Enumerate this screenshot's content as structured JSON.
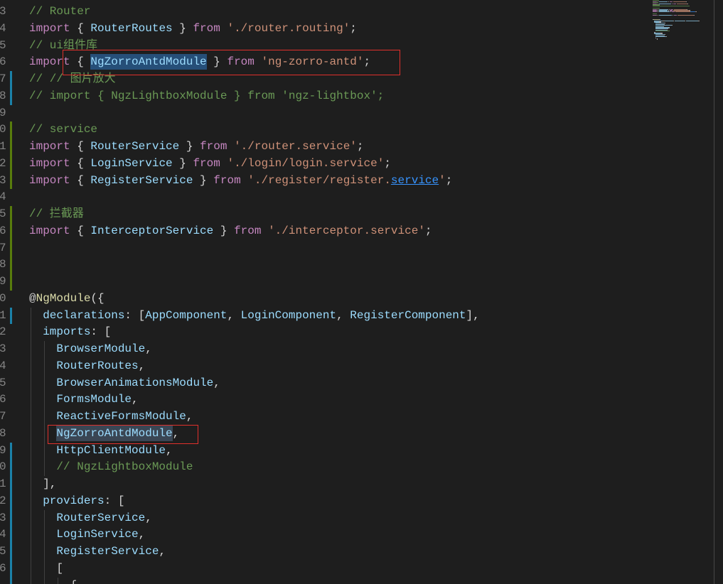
{
  "editor": {
    "lines": [
      {
        "n": "3",
        "t": [
          [
            "#6a9955",
            "// Router"
          ]
        ]
      },
      {
        "n": "4",
        "t": [
          [
            "#c586c0",
            "import"
          ],
          [
            "#d4d4d4",
            " { "
          ],
          [
            "#9cdcfe",
            "RouterRoutes"
          ],
          [
            "#d4d4d4",
            " } "
          ],
          [
            "#c586c0",
            "from"
          ],
          [
            "#d4d4d4",
            " "
          ],
          [
            "#ce9178",
            "'./router.routing'"
          ],
          [
            "#d4d4d4",
            ";"
          ]
        ]
      },
      {
        "n": "5",
        "t": [
          [
            "#6a9955",
            "// ui组件库"
          ]
        ]
      },
      {
        "n": "6",
        "t": [
          [
            "#c586c0",
            "import"
          ],
          [
            "#d4d4d4",
            " { "
          ],
          [
            "#9cdcfe",
            "NgZorroAntdModule",
            "#264f78"
          ],
          [
            "#d4d4d4",
            " } "
          ],
          [
            "#c586c0",
            "from"
          ],
          [
            "#d4d4d4",
            " "
          ],
          [
            "#ce9178",
            "'ng-zorro-antd'"
          ],
          [
            "#d4d4d4",
            ";"
          ]
        ]
      },
      {
        "n": "7",
        "g": "#1b81a8",
        "t": [
          [
            "#6a9955",
            "// // 图片放大"
          ]
        ]
      },
      {
        "n": "8",
        "g": "#1b81a8",
        "t": [
          [
            "#6a9955",
            "// import { NgzLightboxModule } from 'ngz-lightbox';"
          ]
        ]
      },
      {
        "n": "9",
        "t": []
      },
      {
        "n": "0",
        "g": "#587c0c",
        "t": [
          [
            "#6a9955",
            "// service"
          ]
        ]
      },
      {
        "n": "1",
        "g": "#587c0c",
        "t": [
          [
            "#c586c0",
            "import"
          ],
          [
            "#d4d4d4",
            " { "
          ],
          [
            "#9cdcfe",
            "RouterService"
          ],
          [
            "#d4d4d4",
            " } "
          ],
          [
            "#c586c0",
            "from"
          ],
          [
            "#d4d4d4",
            " "
          ],
          [
            "#ce9178",
            "'./router.service'"
          ],
          [
            "#d4d4d4",
            ";"
          ]
        ]
      },
      {
        "n": "2",
        "g": "#587c0c",
        "t": [
          [
            "#c586c0",
            "import"
          ],
          [
            "#d4d4d4",
            " { "
          ],
          [
            "#9cdcfe",
            "LoginService"
          ],
          [
            "#d4d4d4",
            " } "
          ],
          [
            "#c586c0",
            "from"
          ],
          [
            "#d4d4d4",
            " "
          ],
          [
            "#ce9178",
            "'./login/login.service'"
          ],
          [
            "#d4d4d4",
            ";"
          ]
        ]
      },
      {
        "n": "3",
        "g": "#587c0c",
        "t": [
          [
            "#c586c0",
            "import"
          ],
          [
            "#d4d4d4",
            " { "
          ],
          [
            "#9cdcfe",
            "RegisterService"
          ],
          [
            "#d4d4d4",
            " } "
          ],
          [
            "#c586c0",
            "from"
          ],
          [
            "#d4d4d4",
            " "
          ],
          [
            "#ce9178",
            "'./register/register."
          ],
          [
            "#3794ff",
            "service",
            null,
            true
          ],
          [
            "#ce9178",
            "'"
          ],
          [
            "#d4d4d4",
            ";"
          ]
        ]
      },
      {
        "n": "4",
        "t": []
      },
      {
        "n": "5",
        "g": "#587c0c",
        "t": [
          [
            "#6a9955",
            "// 拦截器"
          ]
        ]
      },
      {
        "n": "6",
        "g": "#587c0c",
        "t": [
          [
            "#c586c0",
            "import"
          ],
          [
            "#d4d4d4",
            " { "
          ],
          [
            "#9cdcfe",
            "InterceptorService"
          ],
          [
            "#d4d4d4",
            " } "
          ],
          [
            "#c586c0",
            "from"
          ],
          [
            "#d4d4d4",
            " "
          ],
          [
            "#ce9178",
            "'./interceptor.service'"
          ],
          [
            "#d4d4d4",
            ";"
          ]
        ]
      },
      {
        "n": "7",
        "g": "#587c0c",
        "t": []
      },
      {
        "n": "8",
        "g": "#587c0c",
        "t": []
      },
      {
        "n": "9",
        "g": "#587c0c",
        "t": []
      },
      {
        "n": "0",
        "t": [
          [
            "#d4d4d4",
            "@"
          ],
          [
            "#dcdcaa",
            "NgModule"
          ],
          [
            "#d4d4d4",
            "({"
          ]
        ]
      },
      {
        "n": "1",
        "g": "#1b81a8",
        "t": [
          [
            "#d4d4d4",
            "  "
          ],
          [
            "#9cdcfe",
            "declarations"
          ],
          [
            "#d4d4d4",
            ": ["
          ],
          [
            "#9cdcfe",
            "AppComponent"
          ],
          [
            "#d4d4d4",
            ", "
          ],
          [
            "#9cdcfe",
            "LoginComponent"
          ],
          [
            "#d4d4d4",
            ", "
          ],
          [
            "#9cdcfe",
            "RegisterComponent"
          ],
          [
            "#d4d4d4",
            "],"
          ]
        ]
      },
      {
        "n": "2",
        "t": [
          [
            "#d4d4d4",
            "  "
          ],
          [
            "#9cdcfe",
            "imports"
          ],
          [
            "#d4d4d4",
            ": ["
          ]
        ]
      },
      {
        "n": "3",
        "t": [
          [
            "#d4d4d4",
            "    "
          ],
          [
            "#9cdcfe",
            "BrowserModule"
          ],
          [
            "#d4d4d4",
            ","
          ]
        ]
      },
      {
        "n": "4",
        "t": [
          [
            "#d4d4d4",
            "    "
          ],
          [
            "#9cdcfe",
            "RouterRoutes"
          ],
          [
            "#d4d4d4",
            ","
          ]
        ]
      },
      {
        "n": "5",
        "t": [
          [
            "#d4d4d4",
            "    "
          ],
          [
            "#9cdcfe",
            "BrowserAnimationsModule"
          ],
          [
            "#d4d4d4",
            ","
          ]
        ]
      },
      {
        "n": "6",
        "t": [
          [
            "#d4d4d4",
            "    "
          ],
          [
            "#9cdcfe",
            "FormsModule"
          ],
          [
            "#d4d4d4",
            ","
          ]
        ]
      },
      {
        "n": "7",
        "t": [
          [
            "#d4d4d4",
            "    "
          ],
          [
            "#9cdcfe",
            "ReactiveFormsModule"
          ],
          [
            "#d4d4d4",
            ","
          ]
        ]
      },
      {
        "n": "8",
        "t": [
          [
            "#d4d4d4",
            "    "
          ],
          [
            "#9cdcfe",
            "NgZorroAntdModule",
            "#3a4654"
          ],
          [
            "#d4d4d4",
            ","
          ]
        ]
      },
      {
        "n": "9",
        "g": "#1b81a8",
        "t": [
          [
            "#d4d4d4",
            "    "
          ],
          [
            "#9cdcfe",
            "HttpClientModule"
          ],
          [
            "#d4d4d4",
            ","
          ]
        ]
      },
      {
        "n": "0",
        "g": "#1b81a8",
        "t": [
          [
            "#d4d4d4",
            "    "
          ],
          [
            "#6a9955",
            "// NgzLightboxModule"
          ]
        ]
      },
      {
        "n": "1",
        "g": "#1b81a8",
        "t": [
          [
            "#d4d4d4",
            "  "
          ],
          [
            "#d4d4d4",
            "],"
          ]
        ]
      },
      {
        "n": "2",
        "g": "#1b81a8",
        "t": [
          [
            "#d4d4d4",
            "  "
          ],
          [
            "#9cdcfe",
            "providers"
          ],
          [
            "#d4d4d4",
            ": ["
          ]
        ]
      },
      {
        "n": "3",
        "g": "#1b81a8",
        "t": [
          [
            "#d4d4d4",
            "    "
          ],
          [
            "#9cdcfe",
            "RouterService"
          ],
          [
            "#d4d4d4",
            ","
          ]
        ]
      },
      {
        "n": "4",
        "g": "#1b81a8",
        "t": [
          [
            "#d4d4d4",
            "    "
          ],
          [
            "#9cdcfe",
            "LoginService"
          ],
          [
            "#d4d4d4",
            ","
          ]
        ]
      },
      {
        "n": "5",
        "g": "#1b81a8",
        "t": [
          [
            "#d4d4d4",
            "    "
          ],
          [
            "#9cdcfe",
            "RegisterService"
          ],
          [
            "#d4d4d4",
            ","
          ]
        ]
      },
      {
        "n": "6",
        "g": "#1b81a8",
        "t": [
          [
            "#d4d4d4",
            "    "
          ],
          [
            "#d4d4d4",
            "["
          ]
        ]
      },
      {
        "n": "",
        "g": "#1b81a8",
        "t": [
          [
            "#d4d4d4",
            "      "
          ],
          [
            "#d4d4d4",
            "{"
          ]
        ]
      }
    ]
  }
}
